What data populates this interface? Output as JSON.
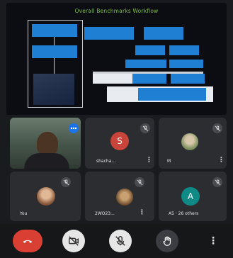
{
  "presentation": {
    "title": "Overall Benchmarks Workflow"
  },
  "participants": [
    {
      "name": "",
      "has_video": true,
      "audio_icon": "speaking-dots-icon"
    },
    {
      "name": "shacha...",
      "avatar_letter": "S",
      "avatar_color": "#c9453b",
      "muted": true
    },
    {
      "name": "M",
      "has_photo": true,
      "muted": true
    },
    {
      "name": "You",
      "has_photo": true,
      "muted": true
    },
    {
      "name": "2WO23...",
      "has_photo": true,
      "muted": true
    },
    {
      "name": "A5 · 26 others",
      "avatar_letter": "A",
      "avatar_color": "#0f8a87",
      "muted": true
    }
  ],
  "controls": [
    {
      "name": "end-call",
      "icon": "phone-hangup-icon",
      "color": "#d93f33"
    },
    {
      "name": "camera",
      "icon": "video-off-icon",
      "color": "#e6e6e6"
    },
    {
      "name": "microphone",
      "icon": "mic-off-icon",
      "color": "#e6e6e6"
    },
    {
      "name": "raise-hand",
      "icon": "hand-icon",
      "color": "#3c3d42"
    },
    {
      "name": "more",
      "icon": "more-vertical-icon",
      "color": "#161719"
    }
  ],
  "colors": {
    "background": "#1a1b1e",
    "tile": "#2c2d31",
    "accent_green": "#7fbf3f",
    "diagram_blue": "#1f7fd2"
  }
}
